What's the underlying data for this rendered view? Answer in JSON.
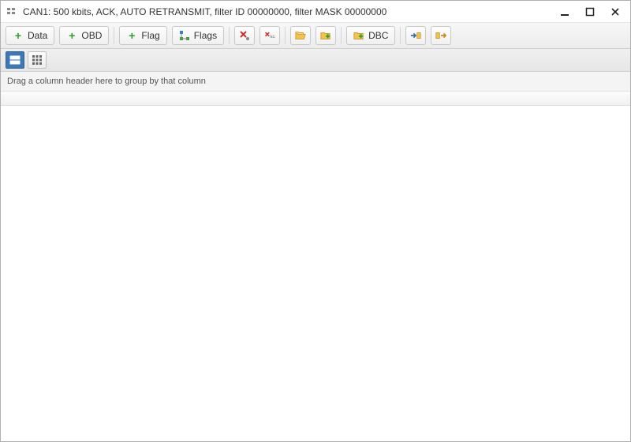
{
  "window": {
    "title": "CAN1: 500 kbits, ACK, AUTO RETRANSMIT, filter ID 00000000, filter MASK 00000000"
  },
  "toolbar": {
    "data_label": "Data",
    "obd_label": "OBD",
    "flag_label": "Flag",
    "flags_label": "Flags",
    "dbc_label": "DBC"
  },
  "groupbar": {
    "hint": "Drag a column header here to group by that column"
  }
}
